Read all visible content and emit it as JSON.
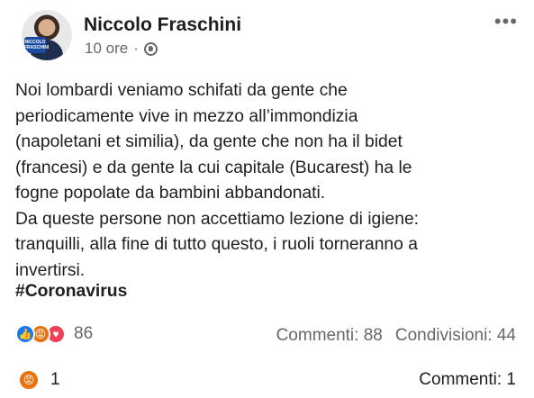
{
  "post": {
    "author": "Niccolo Fraschini",
    "time": "10 ore",
    "separator": "·",
    "privacy_icon": "globe-icon",
    "more_icon": "more-options-icon",
    "more_label": "•••",
    "avatar_badge": "NICCOLO FRASCHINI",
    "text_lines": [
      "Noi lombardi veniamo schifati da gente che",
      "periodicamente vive in mezzo all’immondizia",
      "(napoletani et similia), da gente che non ha il bidet",
      "(francesi) e da gente la cui capitale (Bucarest) ha le",
      "fogne popolate da bambini abbandonati.",
      "Da queste persone non accettiamo lezione di igiene:",
      "tranquilli, alla fine di tutto questo, i ruoli torneranno a",
      "invertirsi."
    ],
    "hashtag": "#Coronavirus",
    "reactions": {
      "icons": [
        "like-reaction-icon",
        "angry-reaction-icon",
        "love-reaction-icon"
      ],
      "count": "86"
    },
    "comments_label": "Commenti: 88",
    "shares_label": "Condivisioni: 44"
  },
  "comment_bar": {
    "reaction_icon": "angry-reaction-icon",
    "reaction_count": "1",
    "comments_label": "Commenti: 1"
  },
  "colors": {
    "text": "#1c1e21",
    "secondary": "#65676b",
    "like": "#1877f2",
    "angry": "#e9710f",
    "love": "#f33e58"
  }
}
